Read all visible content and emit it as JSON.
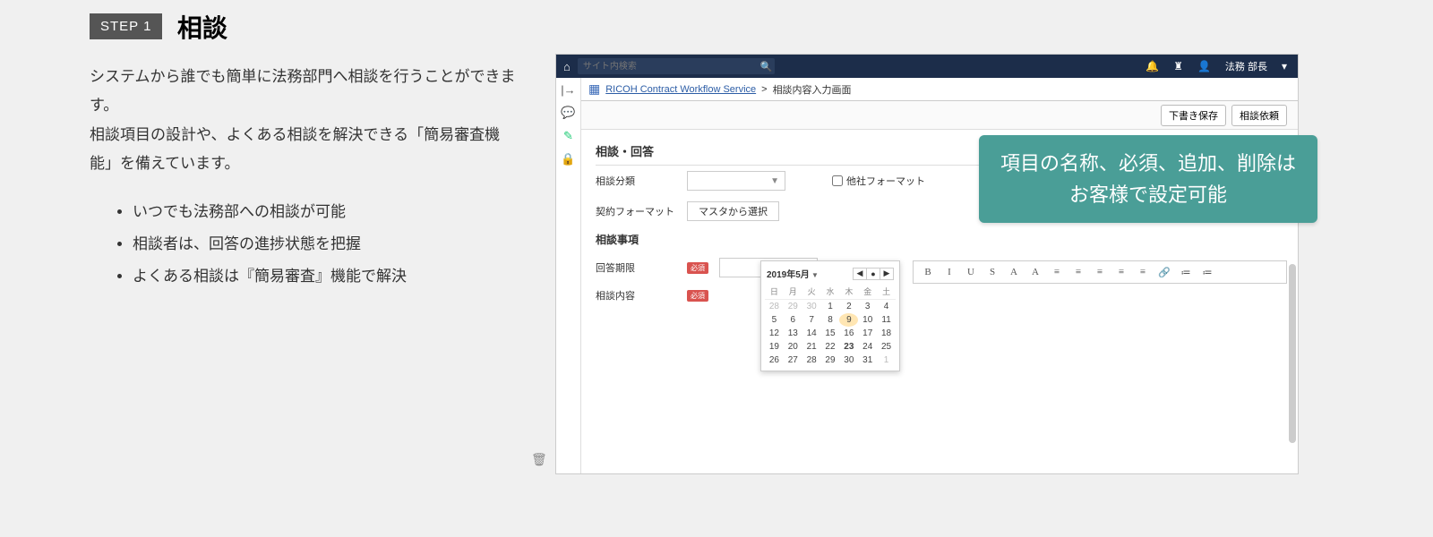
{
  "left": {
    "step_badge": "STEP 1",
    "step_title": "相談",
    "desc_line1": "システムから誰でも簡単に法務部門へ相談を行うことができます。",
    "desc_line2": "相談項目の設計や、よくある相談を解決できる「簡易審査機能」を備えています。",
    "bullets": [
      "いつでも法務部への相談が可能",
      "相談者は、回答の進捗状態を把握",
      "よくある相談は『簡易審査』機能で解決"
    ]
  },
  "app": {
    "search_placeholder": "サイト内検索",
    "user_name": "法務 部長",
    "breadcrumb_app": "RICOH Contract Workflow Service",
    "breadcrumb_page": "相談内容入力画面",
    "btn_draft": "下書き保存",
    "btn_submit": "相談依頼",
    "section_title": "相談・回答",
    "field_category": "相談分類",
    "field_format": "契約フォーマット",
    "btn_master": "マスタから選択",
    "chk_other_format": "他社フォーマット",
    "subsection": "相談事項",
    "field_deadline": "回答期限",
    "field_content": "相談内容",
    "required_badge": "必須"
  },
  "calendar": {
    "month_label": "2019年5月",
    "day_headers": [
      "日",
      "月",
      "火",
      "水",
      "木",
      "金",
      "土"
    ],
    "weeks": [
      [
        {
          "d": "28",
          "mute": true
        },
        {
          "d": "29",
          "mute": true
        },
        {
          "d": "30",
          "mute": true
        },
        {
          "d": "1"
        },
        {
          "d": "2"
        },
        {
          "d": "3"
        },
        {
          "d": "4"
        }
      ],
      [
        {
          "d": "5"
        },
        {
          "d": "6"
        },
        {
          "d": "7"
        },
        {
          "d": "8"
        },
        {
          "d": "9",
          "sel": true
        },
        {
          "d": "10"
        },
        {
          "d": "11"
        }
      ],
      [
        {
          "d": "12"
        },
        {
          "d": "13"
        },
        {
          "d": "14"
        },
        {
          "d": "15"
        },
        {
          "d": "16"
        },
        {
          "d": "17"
        },
        {
          "d": "18"
        }
      ],
      [
        {
          "d": "19"
        },
        {
          "d": "20"
        },
        {
          "d": "21"
        },
        {
          "d": "22"
        },
        {
          "d": "23",
          "today": true
        },
        {
          "d": "24"
        },
        {
          "d": "25"
        }
      ],
      [
        {
          "d": "26"
        },
        {
          "d": "27"
        },
        {
          "d": "28"
        },
        {
          "d": "29"
        },
        {
          "d": "30"
        },
        {
          "d": "31"
        },
        {
          "d": "1",
          "mute": true
        }
      ]
    ]
  },
  "rte_tools": [
    "B",
    "I",
    "U",
    "S",
    "A",
    "A",
    "≡",
    "≡",
    "≡",
    "≡",
    "≡",
    "🔗",
    "≔",
    "≔"
  ],
  "overlay": {
    "line1": "項目の名称、必須、追加、削除は",
    "line2": "お客様で設定可能"
  }
}
